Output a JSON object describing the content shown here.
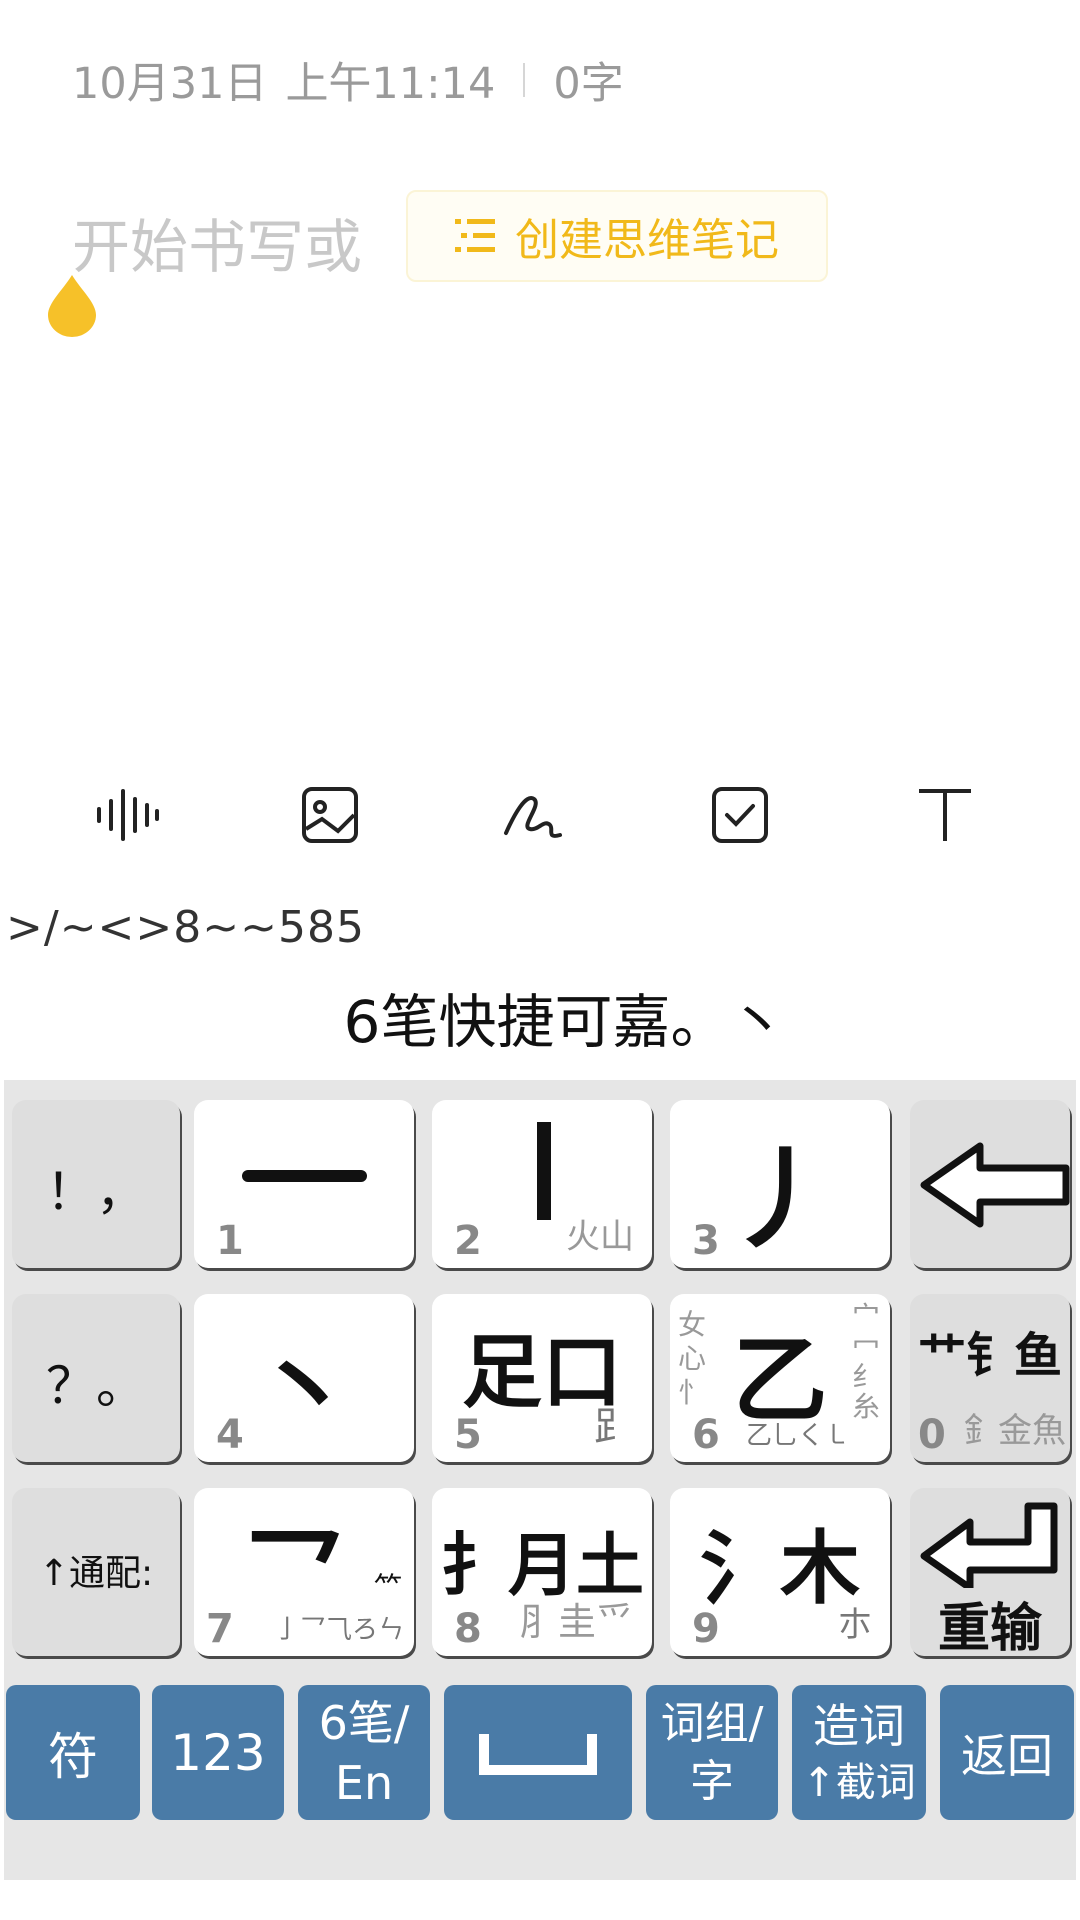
{
  "header": {
    "date": "10月31日",
    "time": "上午11:14",
    "word_count": "0字"
  },
  "editor": {
    "placeholder": "开始书写或",
    "mindmap_label": "创建思维笔记",
    "accent_color": "#f1b91a"
  },
  "toolbar": {
    "items": [
      "voice-icon",
      "image-icon",
      "handwriting-icon",
      "checklist-icon",
      "text-format-icon"
    ]
  },
  "ime": {
    "code": ">/~<>8~~585",
    "candidates": "6笔快捷可嘉。丶",
    "keys": {
      "punct1": "！，",
      "punct2": "？。",
      "wildcard": "↑通配:",
      "k1": {
        "glyph": "一",
        "num": "1"
      },
      "k2": {
        "glyph": "丨",
        "num": "2",
        "sub": "火山"
      },
      "k3": {
        "glyph": "丿",
        "num": "3"
      },
      "k4": {
        "glyph": "丶",
        "num": "4"
      },
      "k5": {
        "glyph": "足口",
        "num": "5",
        "sub": "⻊"
      },
      "k6": {
        "glyph": "乙",
        "num": "6",
        "sub": "乙乚く㇄",
        "left": "女\n心\n忄",
        "right": "宀\n冖\n纟\n糸"
      },
      "k0": {
        "glyph": "艹钅鱼",
        "num": "0",
        "sub": "釒金魚"
      },
      "k7": {
        "glyph": "乛",
        "num": "7",
        "sub": "亅乛⺄ろㄣ",
        "extra": "⺮"
      },
      "k8": {
        "glyph": "扌月土",
        "num": "8",
        "sub": "⺼圭⺤"
      },
      "k9": {
        "glyph": "氵木",
        "num": "9",
        "sub": "朩"
      },
      "enter_label": "重输"
    },
    "bottom": {
      "symbols": "符",
      "numbers": "123",
      "mode_line1": "6笔/",
      "mode_line2": "En",
      "phrase_line1": "词组/",
      "phrase_line2": "字",
      "make_line1": "造词",
      "make_line2": "↑截词",
      "back": "返回"
    },
    "key_color": "#4a7ba7"
  }
}
